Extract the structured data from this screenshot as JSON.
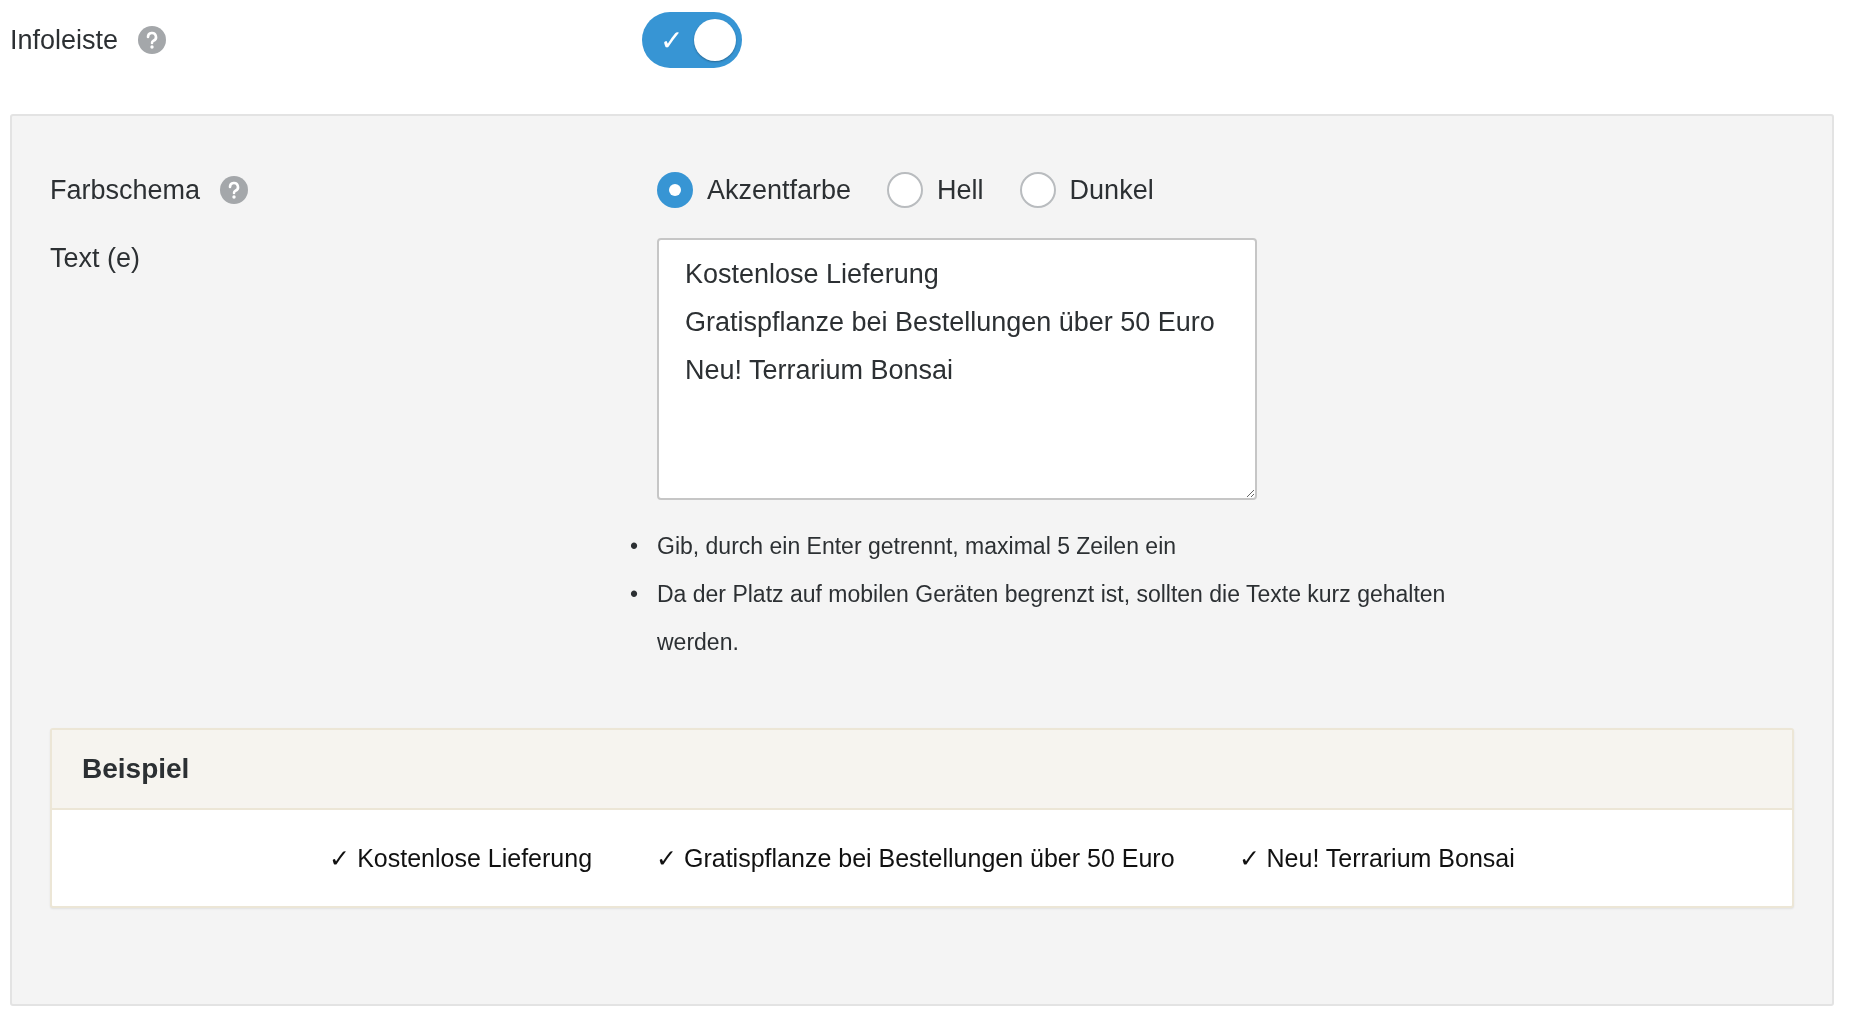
{
  "infoleiste": {
    "label": "Infoleiste",
    "on": true,
    "check": "✓"
  },
  "farbschema": {
    "label": "Farbschema",
    "options": [
      {
        "label": "Akzentfarbe",
        "selected": true
      },
      {
        "label": "Hell",
        "selected": false
      },
      {
        "label": "Dunkel",
        "selected": false
      }
    ]
  },
  "text": {
    "label": "Text (e)",
    "lines": [
      "Kostenlose Lieferung",
      "Gratispflanze bei Bestellungen über 50 Euro",
      "Neu! Terrarium Bonsai"
    ]
  },
  "hints": [
    {
      "bullet": "•",
      "text": "Gib, durch ein Enter getrennt, maximal 5 Zeilen ein"
    },
    {
      "bullet": "•",
      "text": "Da der Platz auf mobilen Geräten begrenzt ist, sollten die Texte kurz gehalten werden."
    }
  ],
  "beispiel": {
    "title": "Beispiel",
    "items": [
      {
        "mark": "✓",
        "text": "Kostenlose Lieferung"
      },
      {
        "mark": "✓",
        "text": "Gratispflanze bei Bestellungen über 50 Euro"
      },
      {
        "mark": "✓",
        "text": "Neu! Terrarium Bonsai"
      }
    ]
  }
}
